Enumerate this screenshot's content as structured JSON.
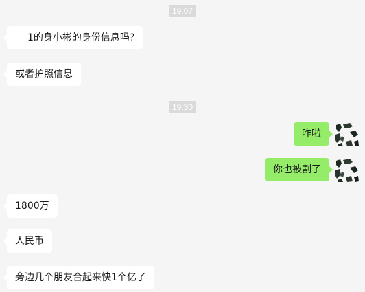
{
  "chat": {
    "timestamp_1": "19:07",
    "timestamp_2": "19:30",
    "messages": [
      {
        "from": "other",
        "text": "1的身小彬的身份信息吗?"
      },
      {
        "from": "other",
        "text": "或者护照信息"
      },
      {
        "from": "self",
        "text": "咋啦"
      },
      {
        "from": "self",
        "text": "你也被割了"
      },
      {
        "from": "other",
        "text": "1800万"
      },
      {
        "from": "other",
        "text": "人民币"
      },
      {
        "from": "other",
        "text": "旁边几个朋友合起来快1个亿了"
      }
    ]
  },
  "colors": {
    "background": "#f5f5f5",
    "incoming_bubble": "#ffffff",
    "outgoing_bubble": "#95ec69",
    "timestamp_bg": "#dadada"
  }
}
